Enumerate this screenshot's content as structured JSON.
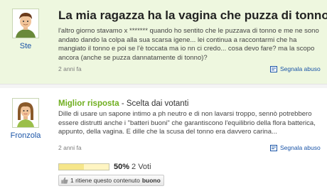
{
  "question": {
    "title": "La mia ragazza ha la vagina che puzza di tonno?",
    "body": "l'altro giorno stavamo x ******* quando ho sentito che le puzzava di tonno e me ne sono andato dando la colpa alla sua scarsa igene... lei continua a raccontarmi che ha mangiato il tonno e poi se l'è toccata ma io nn ci credo... cosa devo fare? ma la scopo ancora (anche se puzza dannatamente di tonno)?",
    "user": "Ste",
    "time": "2 anni fa",
    "report": "Segnala abuso"
  },
  "best_answer": {
    "label": "Miglior risposta",
    "sublabel": " - Scelta dai votanti",
    "body": "Dille di usare un sapone intimo a ph neutro e di non lavarsi troppo, sennò potrebbero essere distrutti anche i \"batteri buoni\" che garantiscono l'equilibrio della flora batterica, appunto, della vagina. E dille che la scusa del tonno era davvero carina...",
    "user": "Fronzola",
    "time": "2 anni fa",
    "report": "Segnala abuso",
    "vote_percent_value": 0.5,
    "vote_percent": "50%",
    "vote_count": "2 Voti",
    "helpful_text": "1 ritiene questo contenuto",
    "helpful_strong": "buono"
  },
  "colors": {
    "question_bg": "#eef7df",
    "link": "#1a54a7",
    "best_label": "#6fae1f"
  }
}
